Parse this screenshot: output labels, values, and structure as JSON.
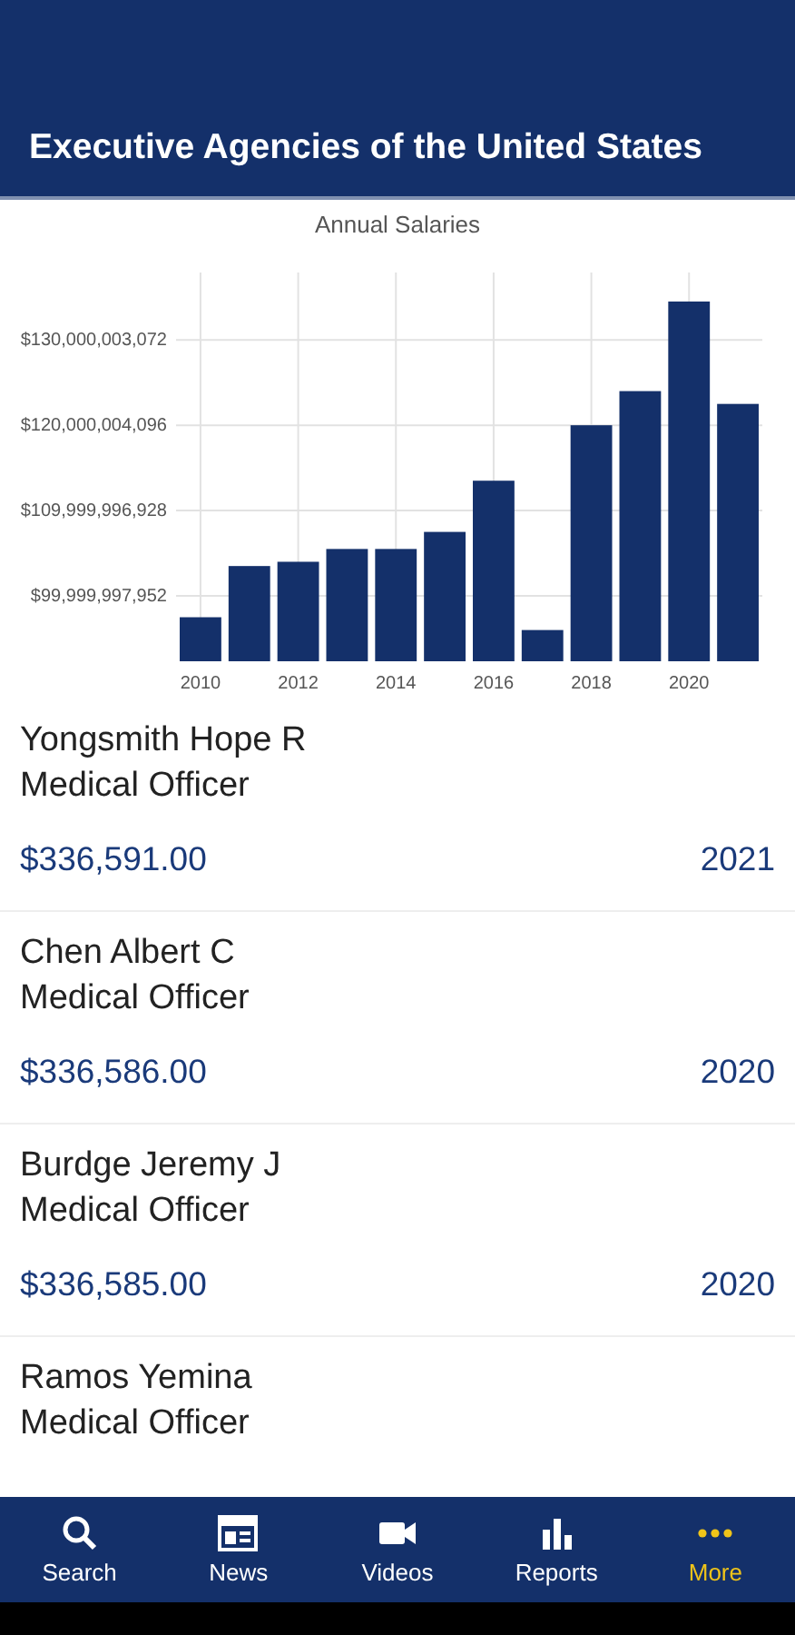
{
  "header": {
    "title": "Executive Agencies of the United States"
  },
  "chart": {
    "chart_data": {
      "type": "bar",
      "title": "Annual Salaries",
      "x": [
        2010,
        2011,
        2012,
        2013,
        2014,
        2015,
        2016,
        2017,
        2018,
        2019,
        2020,
        2021
      ],
      "series": [
        {
          "color": "#14306a",
          "values": [
            97500000000,
            103500000000,
            104000000000,
            105500000000,
            105500000000,
            107500000000,
            113500000000,
            96000000000,
            120000000000,
            124000000000,
            134500000000,
            122500000000
          ]
        }
      ],
      "xlim": [
        2009.5,
        2021.5
      ],
      "ylim": [
        92340000000,
        137900000000
      ],
      "yticks": [
        {
          "value": 99999997952,
          "label": "$99,999,997,952"
        },
        {
          "value": 109999996928,
          "label": "$109,999,996,928"
        },
        {
          "value": 120000004096,
          "label": "$120,000,004,096"
        },
        {
          "value": 130000003072,
          "label": "$130,000,003,072"
        }
      ],
      "xticks": [
        2010,
        2012,
        2014,
        2016,
        2018,
        2020
      ],
      "grid": true
    }
  },
  "employees": [
    {
      "name": "Yongsmith Hope R",
      "title": "Medical Officer",
      "salary": "$336,591.00",
      "year": "2021"
    },
    {
      "name": "Chen Albert C",
      "title": "Medical Officer",
      "salary": "$336,586.00",
      "year": "2020"
    },
    {
      "name": "Burdge Jeremy J",
      "title": "Medical Officer",
      "salary": "$336,585.00",
      "year": "2020"
    },
    {
      "name": "Ramos Yemina",
      "title": "Medical Officer"
    }
  ],
  "nav": [
    {
      "label": "Search",
      "selected": false
    },
    {
      "label": "News",
      "selected": false
    },
    {
      "label": "Videos",
      "selected": false
    },
    {
      "label": "Reports",
      "selected": false
    },
    {
      "label": "More",
      "selected": true
    }
  ]
}
